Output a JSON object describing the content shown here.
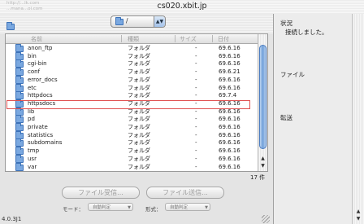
{
  "window": {
    "title": "cs020.xbit.jp",
    "ghost_lines": [
      "http://...lk.com",
      "...mana...ol.com"
    ]
  },
  "toolbar": {
    "path_label": "/"
  },
  "columns": {
    "name": "名前",
    "kind": "種類",
    "size": "サイズ",
    "date": "日付"
  },
  "files": [
    {
      "name": "anon_ftp",
      "kind": "フォルダ",
      "size": "-",
      "date": "69.6.16"
    },
    {
      "name": "bin",
      "kind": "フォルダ",
      "size": "-",
      "date": "69.6.16"
    },
    {
      "name": "cgi-bin",
      "kind": "フォルダ",
      "size": "-",
      "date": "69.6.16"
    },
    {
      "name": "conf",
      "kind": "フォルダ",
      "size": "-",
      "date": "69.6.21"
    },
    {
      "name": "error_docs",
      "kind": "フォルダ",
      "size": "-",
      "date": "69.6.16"
    },
    {
      "name": "etc",
      "kind": "フォルダ",
      "size": "-",
      "date": "69.6.16"
    },
    {
      "name": "httpdocs",
      "kind": "フォルダ",
      "size": "-",
      "date": "69.7.4"
    },
    {
      "name": "httpsdocs",
      "kind": "フォルダ",
      "size": "-",
      "date": "69.6.16"
    },
    {
      "name": "lib",
      "kind": "フォルダ",
      "size": "-",
      "date": "69.6.16"
    },
    {
      "name": "pd",
      "kind": "フォルダ",
      "size": "-",
      "date": "69.6.16"
    },
    {
      "name": "private",
      "kind": "フォルダ",
      "size": "-",
      "date": "69.6.16"
    },
    {
      "name": "statistics",
      "kind": "フォルダ",
      "size": "-",
      "date": "69.6.16"
    },
    {
      "name": "subdomains",
      "kind": "フォルダ",
      "size": "-",
      "date": "69.6.16"
    },
    {
      "name": "tmp",
      "kind": "フォルダ",
      "size": "-",
      "date": "69.6.16"
    },
    {
      "name": "usr",
      "kind": "フォルダ",
      "size": "-",
      "date": "69.6.16"
    },
    {
      "name": "var",
      "kind": "フォルダ",
      "size": "-",
      "date": "69.6.16"
    }
  ],
  "selected_file": "httpsdocs",
  "item_count": "17 件",
  "actions": {
    "receive": "ファイル受信...",
    "send": "ファイル送信..."
  },
  "options": {
    "mode_label": "モード：",
    "mode_value": "自動判定",
    "format_label": "形式：",
    "format_value": "自動判定"
  },
  "status_text": "4.0.3J1",
  "panel": {
    "status_label": "状況",
    "status_value": "接続しました。",
    "file_label": "ファイル",
    "transfer_label": "転送"
  },
  "colors": {
    "selection_border": "#e05050",
    "folder": "#7aa8e0",
    "scroll_thumb": "#6f9fd9"
  }
}
